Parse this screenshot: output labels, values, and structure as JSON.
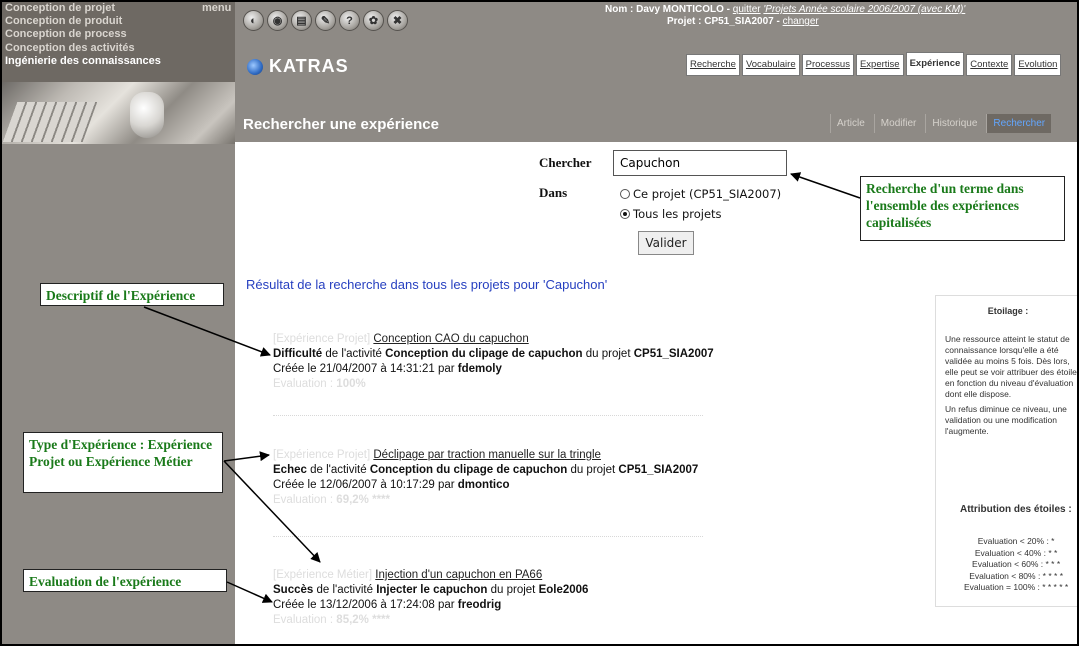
{
  "sidebar": {
    "menu_label": "menu",
    "items": [
      {
        "label": "Conception de projet",
        "active": false
      },
      {
        "label": "Conception de produit",
        "active": false
      },
      {
        "label": "Conception de process",
        "active": false
      },
      {
        "label": "Conception des activités",
        "active": false
      },
      {
        "label": "Ingénierie des connaissances",
        "active": true
      }
    ]
  },
  "toolbar": {
    "icons": [
      "globe-icon",
      "search-icon",
      "document-icon",
      "tools-icon",
      "help-icon",
      "settings-icon",
      "close-icon"
    ],
    "glyphs": [
      "◐",
      "◉",
      "▤",
      "✎",
      "?",
      "✿",
      "✖"
    ]
  },
  "user": {
    "nom_label": "Nom : Davy MONTICOLO - ",
    "quitter": "quitter",
    "projets": "'Projets Année scolaire 2006/2007 (avec KM)'",
    "projet_label": "Projet : CP51_SIA2007 - ",
    "changer": "changer"
  },
  "app": {
    "title": "KATRAS"
  },
  "tabs": [
    {
      "label": "Recherche",
      "active": false
    },
    {
      "label": "Vocabulaire",
      "active": false
    },
    {
      "label": "Processus",
      "active": false
    },
    {
      "label": "Expertise",
      "active": false
    },
    {
      "label": "Expérience",
      "active": true
    },
    {
      "label": "Contexte",
      "active": false
    },
    {
      "label": "Evolution",
      "active": false
    }
  ],
  "page": {
    "title": "Rechercher une expérience"
  },
  "subtabs": [
    {
      "label": "Article",
      "active": false
    },
    {
      "label": "Modifier",
      "active": false
    },
    {
      "label": "Historique",
      "active": false
    },
    {
      "label": "Rechercher",
      "active": true
    }
  ],
  "search": {
    "chercher_label": "Chercher",
    "value": "Capuchon",
    "dans_label": "Dans",
    "option1": "Ce projet (CP51_SIA2007)",
    "option2": "Tous les projets",
    "selected": "Tous les projets",
    "submit": "Valider"
  },
  "annotations": {
    "recherche": "Recherche d'un terme dans l'ensemble des expériences capitalisées",
    "descriptif": "Descriptif de l'Expérience",
    "type": "Type d'Expérience : Expérience Projet ou Expérience Métier",
    "evaluation": "Evaluation de l'expérience"
  },
  "results": {
    "heading": "Résultat de la recherche dans tous les projets pour 'Capuchon'",
    "items": [
      {
        "type": "[Expérience Projet]",
        "title": "Conception CAO du capuchon",
        "status": "Difficulté",
        "de_activite": " de l'activité ",
        "activity": "Conception du clipage de capuchon",
        "du_projet": " du projet ",
        "project": "CP51_SIA2007",
        "created": "Créée le 21/04/2007 à 14:31:21 par ",
        "author": "fdemoly",
        "eval_label": "Evaluation : ",
        "eval_value": "100%"
      },
      {
        "type": "[Expérience Projet]",
        "title": "Déclipage par traction manuelle sur la tringle",
        "status": "Echec",
        "de_activite": " de l'activité ",
        "activity": "Conception du clipage de capuchon",
        "du_projet": " du projet ",
        "project": "CP51_SIA2007",
        "created": "Créée le 12/06/2007 à 10:17:29 par ",
        "author": "dmontico",
        "eval_label": "Evaluation : ",
        "eval_value": "69,2% ****"
      },
      {
        "type": "[Expérience Métier]",
        "title": "Injection d'un capuchon en PA66",
        "status": "Succès",
        "de_activite": " de l'activité ",
        "activity": "Injecter le capuchon",
        "du_projet": " du projet ",
        "project": "Eole2006",
        "created": "Créée le 13/12/2006 à 17:24:08 par ",
        "author": "freodrig",
        "eval_label": "Evaluation : ",
        "eval_value": "85,2% ****"
      }
    ]
  },
  "etoilage": {
    "title": "Etoilage :",
    "para1": "Une ressource atteint le statut de connaissance lorsqu'elle a été validée au moins 5 fois. Dès lors, elle peut se voir attribuer des étoiles en fonction du niveau d'évaluation dont elle dispose.",
    "para2": "Un refus diminue ce niveau, une validation ou une modification l'augmente.",
    "attribution": "Attribution des étoiles :",
    "rules": [
      "Evaluation < 20% : *",
      "Evaluation < 40% : * *",
      "Evaluation < 60% : * * *",
      "Evaluation < 80% : * * * *",
      "Evaluation = 100% : * * * * *"
    ]
  }
}
